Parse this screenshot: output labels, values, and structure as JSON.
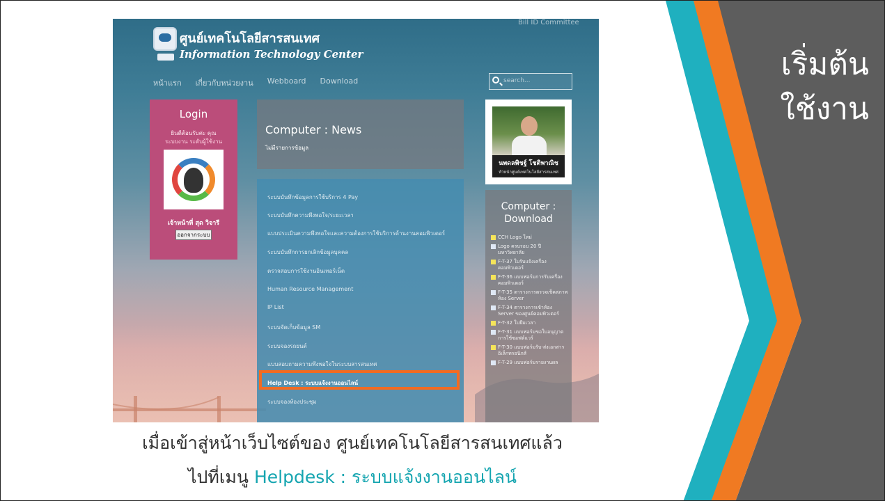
{
  "slide": {
    "title_line1": "เริ่มต้น",
    "title_line2": "ใช้งาน",
    "caption_line1": "เมื่อเข้าสู่หน้าเว็บไซต์ของ ศูนย์เทคโนโลยีสารสนเทศแล้ว",
    "caption_line2_prefix": "ไปที่เมนู ",
    "caption_line2_accent": "Helpdesk : ระบบแจ้งงานออนไลน์",
    "colors": {
      "teal": "#1fb0bf",
      "orange": "#f07a22",
      "dark": "#5d5d5d",
      "accent_text": "#15a5b0",
      "highlight": "#f26b22"
    }
  },
  "website": {
    "site_name_th": "ศูนย์เทคโนโลยีสารสนเทศ",
    "site_name_en": "Information Technology Center",
    "top_user": "Bill ID Committee",
    "nav": [
      "หน้าแรก",
      "เกี่ยวกับหน่วยงาน",
      "Webboard",
      "Download"
    ],
    "search_placeholder": "search...",
    "login": {
      "title": "Login",
      "welcome1": "ยินดีต้อนรับค่ะ คุณ",
      "welcome2": "ระบบงาน ระดับผู้ใช้งาน",
      "user_name": "เจ้าหน้าที่ สุด วิจารี",
      "logout_label": "ออกจากระบบ"
    },
    "news": {
      "title": "Computer : News",
      "subtitle": "ไม่มีรายการข้อมูล"
    },
    "menu": [
      "ระบบบันทึกข้อมูลการใช้บริการ 4 Pay",
      "ระบบบันทึกความพึงพอใจ/ระยะเวลา",
      "แบบประเมินความพึงพอใจและความต้องการใช้บริการด้านงานคอมพิวเตอร์",
      "ระบบบันทึกการยกเลิกข้อมูลบุคคล",
      "ตรวจสอบการใช้งานอินเทอร์เน็ต",
      "Human Resource Management",
      "IP List",
      "ระบบจัดเก็บข้อมูล SM",
      "ระบบจองรถยนต์",
      "แบบสอบถามความพึงพอใจในระบบสารสนเทศ",
      "Help Desk : ระบบแจ้งงานออนไลน์",
      "ระบบจองห้องประชุม"
    ],
    "menu_highlight_index": 10,
    "profile": {
      "name": "นพดลพิชฐ์ โชติพาณิช",
      "role": "หัวหน้าศูนย์เทคโนโลยีสารสนเทศ"
    },
    "download": {
      "title1": "Computer :",
      "title2": "Download",
      "items": [
        {
          "icon": "star-icon",
          "text": "CCH Logo ใหม่"
        },
        {
          "icon": "doc-icon",
          "text": "Logo ครบรอบ 20 ปี มหาวิทยาลัย"
        },
        {
          "icon": "star-icon",
          "text": "F-T-37 ใบรับแจ้งเครื่องคอมพิวเตอร์"
        },
        {
          "icon": "star-icon",
          "text": "F-T-36 แบบฟอร์มการรับเครื่องคอมพิวเตอร์"
        },
        {
          "icon": "doc-icon",
          "text": "F-T-35 ตารางการตรวจเช็คสภาพห้อง Server"
        },
        {
          "icon": "doc-icon",
          "text": "F-T-34 ตารางการเข้าห้อง Server ของศูนย์คอมพิวเตอร์"
        },
        {
          "icon": "star-icon",
          "text": "F-T-32 ใบยืมเวลา"
        },
        {
          "icon": "doc-icon",
          "text": "F-T-31 แบบฟอร์มขอใบอนุญาตการใช้ซอฟต์แวร์"
        },
        {
          "icon": "star-icon",
          "text": "F-T-30 แบบฟอร์มรับ-ส่งเอกสาร อิเล็กทรอนิกส์"
        },
        {
          "icon": "doc-icon",
          "text": "F-T-29 แบบฟอร์มรายงานผล"
        }
      ]
    }
  }
}
